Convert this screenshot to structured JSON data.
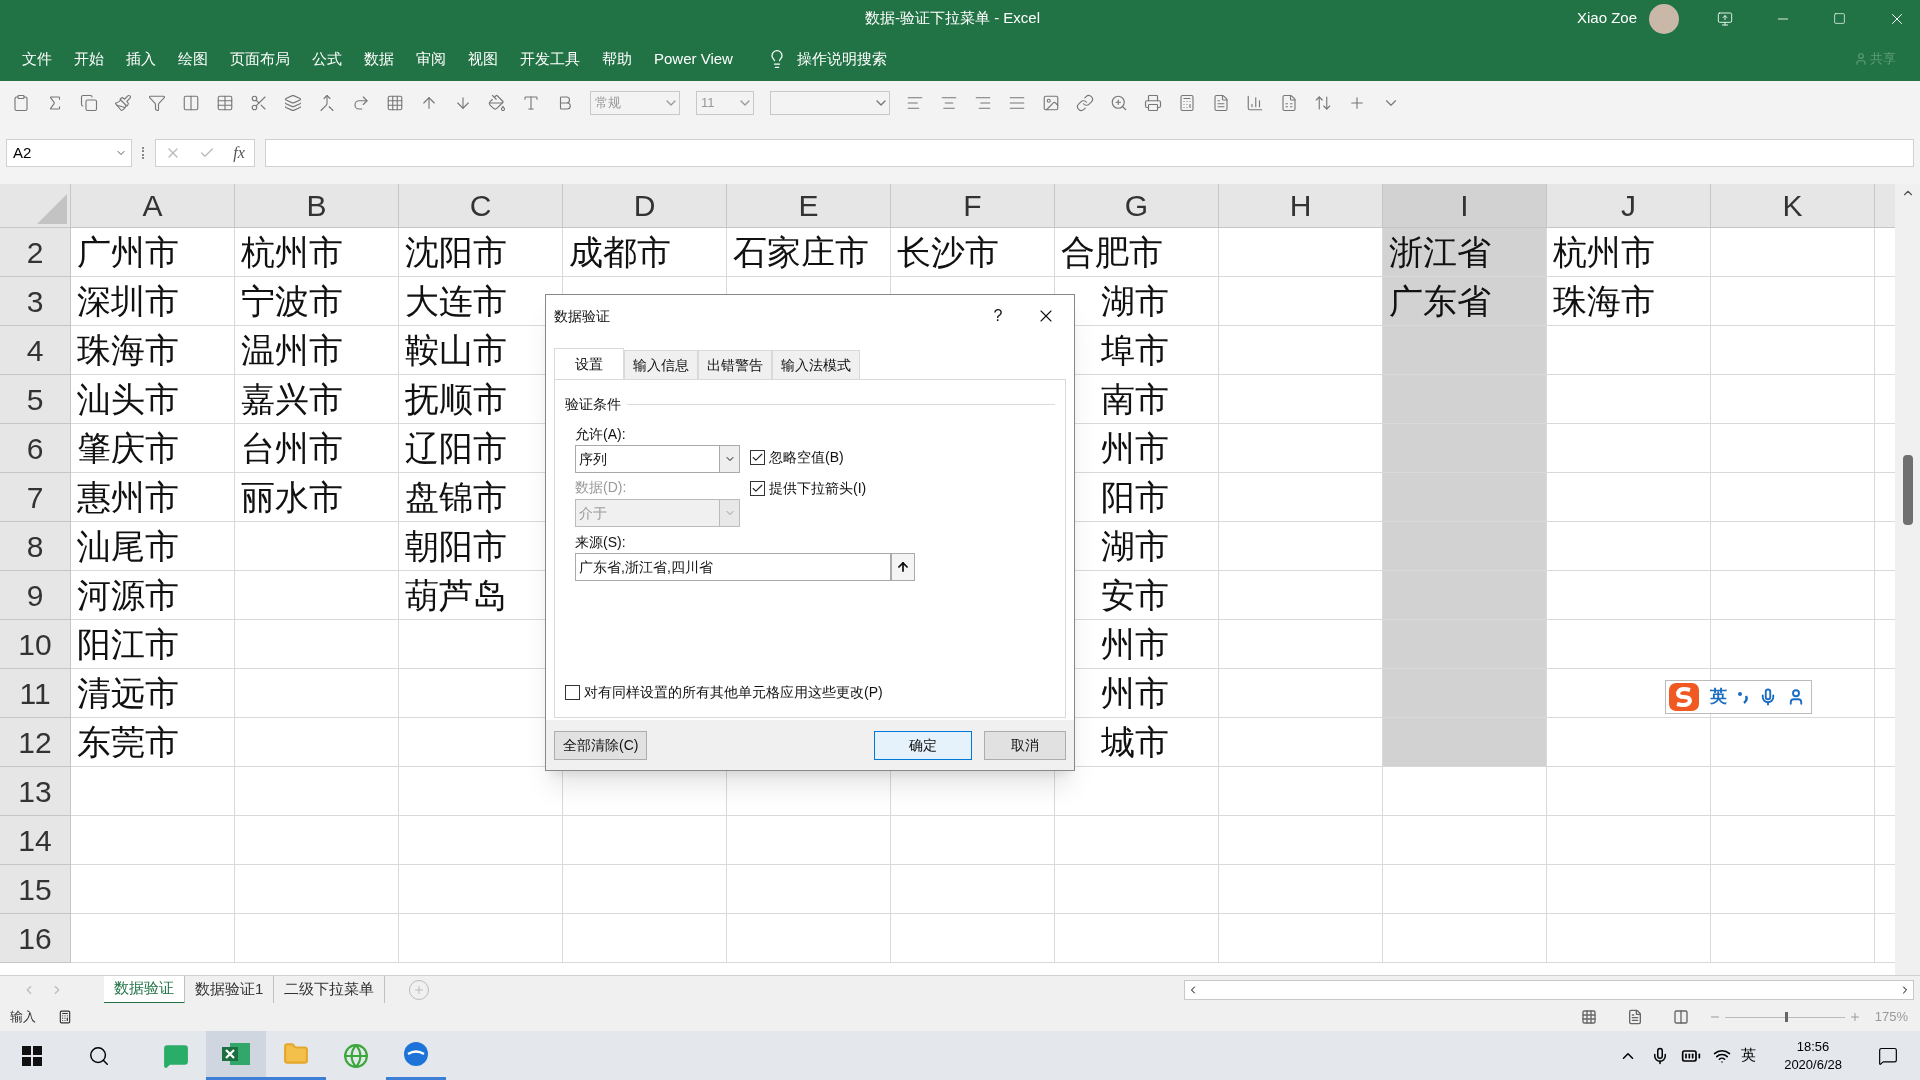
{
  "window": {
    "title": "数据-验证下拉菜单 - Excel",
    "user": "Xiao Zoe"
  },
  "ribbon": {
    "tabs": [
      {
        "label": "文件",
        "selected": false
      },
      {
        "label": "开始",
        "selected": false
      },
      {
        "label": "插入",
        "selected": false
      },
      {
        "label": "绘图",
        "selected": false
      },
      {
        "label": "页面布局",
        "selected": false
      },
      {
        "label": "公式",
        "selected": false
      },
      {
        "label": "数据",
        "selected": false
      },
      {
        "label": "审阅",
        "selected": false
      },
      {
        "label": "视图",
        "selected": false
      },
      {
        "label": "开发工具",
        "selected": false
      },
      {
        "label": "帮助",
        "selected": false
      },
      {
        "label": "Power View",
        "selected": false
      }
    ],
    "search": "操作说明搜索",
    "share": "共享"
  },
  "toolbar": {
    "number_format": "常规",
    "font_size": "11"
  },
  "formula_bar": {
    "name_box": "A2",
    "function_label": "fx"
  },
  "sheet": {
    "columns": [
      {
        "label": "A",
        "highlighted": false
      },
      {
        "label": "B",
        "highlighted": false
      },
      {
        "label": "C",
        "highlighted": false
      },
      {
        "label": "D",
        "highlighted": false
      },
      {
        "label": "E",
        "highlighted": false
      },
      {
        "label": "F",
        "highlighted": false
      },
      {
        "label": "G",
        "highlighted": false
      },
      {
        "label": "H",
        "highlighted": false
      },
      {
        "label": "I",
        "highlighted": true
      },
      {
        "label": "J",
        "highlighted": false
      },
      {
        "label": "K",
        "highlighted": false
      }
    ],
    "rows": [
      {
        "number": "2",
        "highlighted": true,
        "cells": [
          "广州市",
          "杭州市",
          "沈阳市",
          "成都市",
          "石家庄市",
          "长沙市",
          "合肥市",
          null,
          "浙江省",
          "杭州市",
          null
        ]
      },
      {
        "number": "3",
        "highlighted": true,
        "cells": [
          "深圳市",
          "宁波市",
          "大连市",
          null,
          null,
          null,
          "湖市",
          null,
          "广东省",
          "珠海市",
          null
        ]
      },
      {
        "number": "4",
        "highlighted": true,
        "cells": [
          "珠海市",
          "温州市",
          "鞍山市",
          null,
          null,
          null,
          "埠市",
          null,
          null,
          null,
          null
        ]
      },
      {
        "number": "5",
        "highlighted": true,
        "cells": [
          "汕头市",
          "嘉兴市",
          "抚顺市",
          null,
          null,
          null,
          "南市",
          null,
          null,
          null,
          null
        ]
      },
      {
        "number": "6",
        "highlighted": true,
        "cells": [
          "肇庆市",
          "台州市",
          "辽阳市",
          null,
          null,
          null,
          "州市",
          null,
          null,
          null,
          null
        ]
      },
      {
        "number": "7",
        "highlighted": true,
        "cells": [
          "惠州市",
          "丽水市",
          "盘锦市",
          null,
          null,
          null,
          "阳市",
          null,
          null,
          null,
          null
        ]
      },
      {
        "number": "8",
        "highlighted": true,
        "cells": [
          "汕尾市",
          null,
          "朝阳市",
          null,
          null,
          null,
          "湖市",
          null,
          null,
          null,
          null
        ]
      },
      {
        "number": "9",
        "highlighted": true,
        "cells": [
          "河源市",
          null,
          "葫芦岛",
          null,
          null,
          null,
          "安市",
          null,
          null,
          null,
          null
        ]
      },
      {
        "number": "10",
        "highlighted": true,
        "cells": [
          "阳江市",
          null,
          null,
          null,
          null,
          null,
          "州市",
          null,
          null,
          null,
          null
        ]
      },
      {
        "number": "11",
        "highlighted": true,
        "cells": [
          "清远市",
          null,
          null,
          null,
          null,
          null,
          "州市",
          null,
          null,
          null,
          null
        ]
      },
      {
        "number": "12",
        "highlighted": true,
        "cells": [
          "东莞市",
          null,
          null,
          null,
          null,
          null,
          "城市",
          null,
          null,
          null,
          null
        ]
      },
      {
        "number": "13",
        "highlighted": false,
        "cells": []
      },
      {
        "number": "14",
        "highlighted": false,
        "cells": []
      },
      {
        "number": "15",
        "highlighted": false,
        "cells": []
      },
      {
        "number": "16",
        "highlighted": false,
        "cells": []
      }
    ]
  },
  "dialog": {
    "title": "数据验证",
    "help": "?",
    "tabs": [
      {
        "label": "设置",
        "selected": true
      },
      {
        "label": "输入信息",
        "selected": false
      },
      {
        "label": "出错警告",
        "selected": false
      },
      {
        "label": "输入法模式",
        "selected": false
      }
    ],
    "group": "验证条件",
    "allow": {
      "label": "允许(A):",
      "value": "序列"
    },
    "data": {
      "label": "数据(D):",
      "value": "介于",
      "disabled": true
    },
    "checks": [
      {
        "label": "忽略空值(B)",
        "checked": true
      },
      {
        "label": "提供下拉箭头(I)",
        "checked": true
      }
    ],
    "source": {
      "label": "来源(S):",
      "value": "广东省,浙江省,四川省"
    },
    "apply_all": {
      "label": "对有同样设置的所有其他单元格应用这些更改(P)",
      "checked": false
    },
    "buttons": [
      {
        "label": "全部清除(C)",
        "default": false
      },
      {
        "label": "确定",
        "default": true
      },
      {
        "label": "取消",
        "default": false
      }
    ]
  },
  "sheet_tabs": [
    {
      "label": "数据验证",
      "selected": true
    },
    {
      "label": "数据验证1",
      "selected": false
    },
    {
      "label": "二级下拉菜单",
      "selected": false
    }
  ],
  "status_bar": {
    "mode": "输入",
    "zoom": {
      "level": 0.5,
      "reading": "175%"
    }
  },
  "ime_bar": {
    "mode": "英"
  },
  "taskbar": {
    "input_indicator": "英",
    "time": "18:56",
    "date": "2020/6/28"
  }
}
